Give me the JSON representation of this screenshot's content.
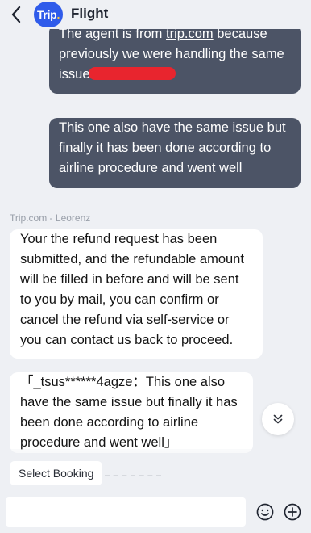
{
  "header": {
    "logo_text": "Trip",
    "logo_dot": ".",
    "title": "Flight"
  },
  "messages": {
    "user1": {
      "text_before_link": "The agent is from ",
      "link": "trip.com",
      "text_after_link": " because previously we were handling the same issue"
    },
    "user2": {
      "text": "This one also have the same issue but finally it has been done according to airline procedure and went well"
    },
    "sender_label": "Trip.com - Leorenz",
    "agent1": {
      "text": "Your the refund request has been submitted, and the refundable amount will be filled in before and will be sent to you by mail, you can confirm or cancel the refund via self-service or you can contact us back to proceed."
    },
    "agent2": {
      "text": "「_tsus******4agze：This one also have the same issue but finally it has been done according to airline procedure and went well」"
    }
  },
  "quick_actions": {
    "select_booking": "Select Booking"
  },
  "composer": {
    "placeholder": ""
  },
  "icons": {
    "back": "chevron-left-icon",
    "scroll_down": "double-chevron-down-icon",
    "emoji": "smiley-icon",
    "add": "plus-circle-icon"
  },
  "colors": {
    "user_bubble": "#4c5466",
    "agent_bubble": "#ffffff",
    "background": "#eef0f4",
    "brand": "#2f5bea",
    "redaction": "#e8252e"
  }
}
